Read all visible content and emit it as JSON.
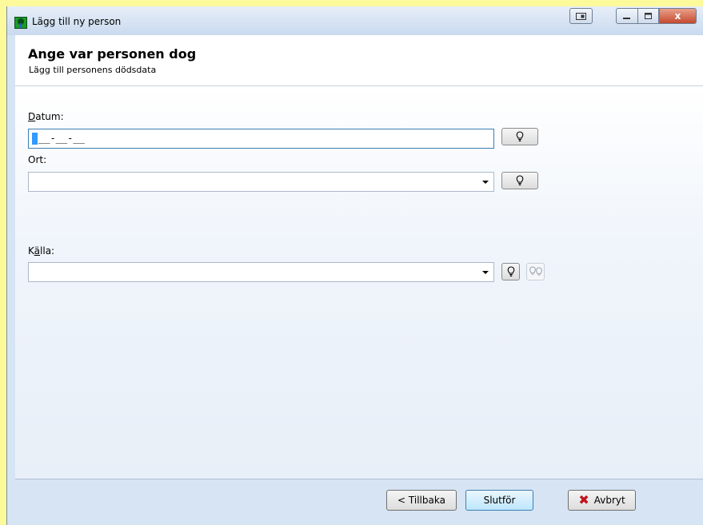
{
  "window": {
    "title": "Lägg till ny person",
    "close_glyph": "x"
  },
  "header": {
    "title": "Ange var personen dog",
    "subtitle": "Lägg till personens dödsdata"
  },
  "form": {
    "datum": {
      "label_accesskey": "D",
      "label_rest": "atum:",
      "value": "__-__-__"
    },
    "ort": {
      "label": "Ort:",
      "value": ""
    },
    "kalla": {
      "label_pre": "K",
      "label_accesskey": "ä",
      "label_rest": "lla:",
      "value": ""
    }
  },
  "buttons": {
    "back": "< Tillbaka",
    "finish": "Slutför",
    "cancel": "Avbryt"
  }
}
